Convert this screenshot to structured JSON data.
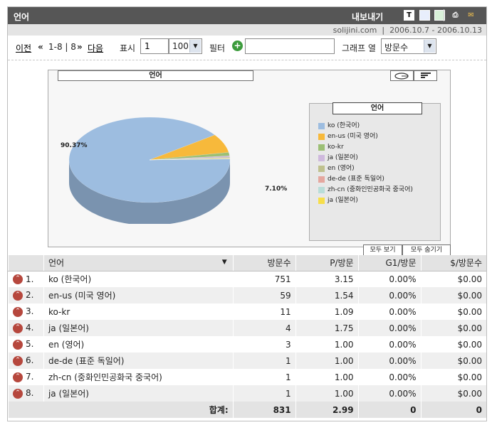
{
  "header": {
    "title": "언어",
    "export_label": "내보내기"
  },
  "meta": {
    "site": "solijini.com",
    "date_range": "2006.10.7 - 2006.10.13"
  },
  "toolbar": {
    "prev": "이전",
    "range": "1-8 | 8",
    "next": "다음",
    "show_label": "표시",
    "page_value": "1",
    "per_page": "100",
    "filter_label": "필터",
    "filter_value": "",
    "graph_col_label": "그래프 열",
    "graph_col_value": "방문수"
  },
  "chart_data": {
    "type": "pie",
    "title": "언어",
    "legend_title": "언어",
    "categories": [
      "ko (한국어)",
      "en-us (미국 영어)",
      "ko-kr",
      "ja (일본어)",
      "en (영어)",
      "de-de (표준 독일어)",
      "zh-cn (중화인민공화국 중국어)",
      "ja (일본어)"
    ],
    "values": [
      751,
      59,
      11,
      4,
      3,
      1,
      1,
      1
    ],
    "colors": [
      "#9dbde0",
      "#f7b93b",
      "#9cbf75",
      "#cfb9dd",
      "#bfc18e",
      "#e5a79f",
      "#b9ddd8",
      "#f7de4a"
    ],
    "data_labels": [
      "90.37%",
      "7.10%"
    ],
    "buttons": [
      "모두 보기",
      "모두 숨기기"
    ]
  },
  "table": {
    "columns": [
      "언어",
      "방문수",
      "P/방문",
      "G1/방문",
      "$/방문수"
    ],
    "rows": [
      {
        "rank": "1.",
        "name": "ko (한국어)",
        "visits": "751",
        "pv": "3.15",
        "g1": "0.00%",
        "rev": "$0.00"
      },
      {
        "rank": "2.",
        "name": "en-us (미국 영어)",
        "visits": "59",
        "pv": "1.54",
        "g1": "0.00%",
        "rev": "$0.00"
      },
      {
        "rank": "3.",
        "name": "ko-kr",
        "visits": "11",
        "pv": "1.09",
        "g1": "0.00%",
        "rev": "$0.00"
      },
      {
        "rank": "4.",
        "name": "ja (일본어)",
        "visits": "4",
        "pv": "1.75",
        "g1": "0.00%",
        "rev": "$0.00"
      },
      {
        "rank": "5.",
        "name": "en (영어)",
        "visits": "3",
        "pv": "1.00",
        "g1": "0.00%",
        "rev": "$0.00"
      },
      {
        "rank": "6.",
        "name": "de-de (표준 독일어)",
        "visits": "1",
        "pv": "1.00",
        "g1": "0.00%",
        "rev": "$0.00"
      },
      {
        "rank": "7.",
        "name": "zh-cn (중화인민공화국 중국어)",
        "visits": "1",
        "pv": "1.00",
        "g1": "0.00%",
        "rev": "$0.00"
      },
      {
        "rank": "8.",
        "name": "ja (일본어)",
        "visits": "1",
        "pv": "1.00",
        "g1": "0.00%",
        "rev": "$0.00"
      }
    ],
    "total": {
      "label": "합계:",
      "visits": "831",
      "pv": "2.99",
      "g1": "0",
      "rev": "0"
    }
  }
}
